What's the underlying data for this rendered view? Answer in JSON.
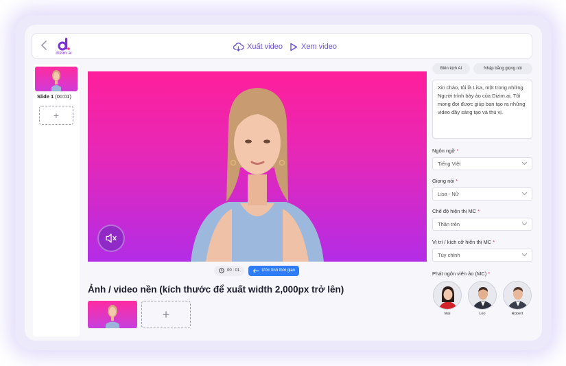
{
  "app": {
    "logo_text": "dizim ai"
  },
  "toolbar": {
    "export_label": "Xuất video",
    "preview_label": "Xem video"
  },
  "slides": {
    "items": [
      {
        "title": "Slide 1",
        "duration": "(00:01)"
      }
    ],
    "add_label": "+"
  },
  "player": {
    "time": "00 : 01",
    "estimate_label": "Ước tính thời gian"
  },
  "background": {
    "title": "Ảnh / video nền (kích thước để xuất width 2,000px trở lên)",
    "add_label": "+"
  },
  "panel": {
    "tabs": [
      {
        "label": "Biên kịch AI"
      },
      {
        "label": "Nhập bằng giọng nói"
      }
    ],
    "script_text": "Xin chào, tôi là Lisa, một trong những Người trình bày ảo của Dizim.ai. Tôi mong đợi được giúp bạn tạo ra những video đầy sáng tạo và thú vị.",
    "required_mark": "*",
    "fields": {
      "language": {
        "label": "Ngôn ngữ",
        "value": "Tiếng Việt"
      },
      "voice": {
        "label": "Giọng nói",
        "value": "Lisa - Nữ"
      },
      "mc_mode": {
        "label": "Chế độ hiện thị MC",
        "value": "Thân trên"
      },
      "mc_position": {
        "label": "Vị trí / kích cỡ hiển thị MC",
        "value": "Tùy chỉnh"
      }
    },
    "mc_label": "Phát ngôn viên ảo (MC)",
    "presenters": [
      {
        "name": "Mai"
      },
      {
        "name": "Leo"
      },
      {
        "name": "Robert"
      }
    ]
  },
  "colors": {
    "accent": "#6b4fd8",
    "video_top": "#ff1f9b",
    "video_bottom": "#b32ce6",
    "estimate_button": "#2f7df6"
  },
  "icons": {
    "back": "chevron-left-icon",
    "export": "cloud-download-icon",
    "preview": "play-icon",
    "mute": "speaker-muted-icon",
    "clock": "clock-icon",
    "arrow": "arrow-left-icon",
    "dropdown": "chevron-down-icon"
  }
}
